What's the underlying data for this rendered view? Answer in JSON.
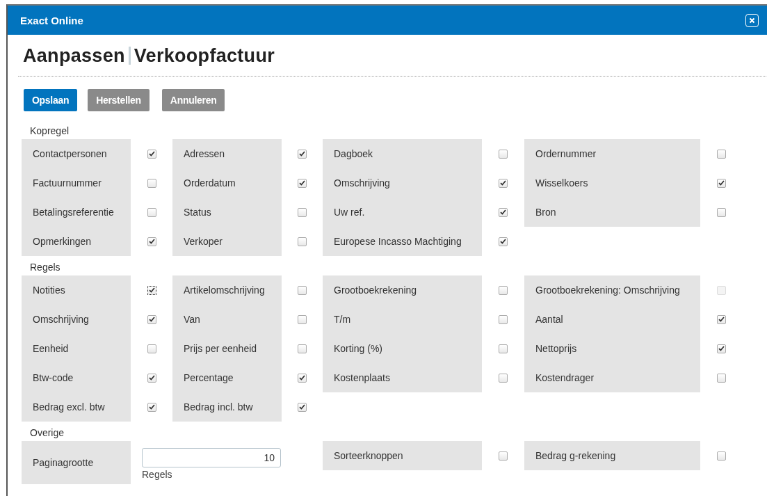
{
  "window": {
    "title": "Exact Online"
  },
  "heading": {
    "action": "Aanpassen",
    "subject": "Verkoopfactuur"
  },
  "buttons": [
    {
      "label": "Opslaan",
      "kind": "primary"
    },
    {
      "label": "Herstellen",
      "kind": "secondary"
    },
    {
      "label": "Annuleren",
      "kind": "secondary"
    }
  ],
  "sections": [
    {
      "title": "Kopregel",
      "columns": [
        [
          {
            "label": "Contactpersonen",
            "kind": "checkbox",
            "checked": true
          },
          {
            "label": "Factuurnummer",
            "kind": "checkbox",
            "checked": false
          },
          {
            "label": "Betalingsreferentie",
            "kind": "checkbox",
            "checked": false
          },
          {
            "label": "Opmerkingen",
            "kind": "checkbox",
            "checked": true
          }
        ],
        [
          {
            "label": "Adressen",
            "kind": "checkbox",
            "checked": true
          },
          {
            "label": "Orderdatum",
            "kind": "checkbox",
            "checked": true
          },
          {
            "label": "Status",
            "kind": "checkbox",
            "checked": false
          },
          {
            "label": "Verkoper",
            "kind": "checkbox",
            "checked": false
          }
        ],
        [
          {
            "label": "Dagboek",
            "kind": "checkbox",
            "checked": false
          },
          {
            "label": "Omschrijving",
            "kind": "checkbox",
            "checked": true
          },
          {
            "label": "Uw ref.",
            "kind": "checkbox",
            "checked": true
          },
          {
            "label": "Europese Incasso Machtiging",
            "kind": "checkbox",
            "checked": true
          }
        ],
        [
          {
            "label": "Ordernummer",
            "kind": "checkbox",
            "checked": false
          },
          {
            "label": "Wisselkoers",
            "kind": "checkbox",
            "checked": true
          },
          {
            "label": "Bron",
            "kind": "checkbox",
            "checked": false
          }
        ]
      ]
    },
    {
      "title": "Regels",
      "columns": [
        [
          {
            "label": "Notities",
            "kind": "checkbox",
            "checked": true,
            "focused": true
          },
          {
            "label": "Omschrijving",
            "kind": "checkbox",
            "checked": true
          },
          {
            "label": "Eenheid",
            "kind": "checkbox",
            "checked": false
          },
          {
            "label": "Btw-code",
            "kind": "checkbox",
            "checked": true
          },
          {
            "label": "Bedrag excl. btw",
            "kind": "checkbox",
            "checked": true
          }
        ],
        [
          {
            "label": "Artikelomschrijving",
            "kind": "checkbox",
            "checked": false
          },
          {
            "label": "Van",
            "kind": "checkbox",
            "checked": false
          },
          {
            "label": "Prijs per eenheid",
            "kind": "checkbox",
            "checked": false
          },
          {
            "label": "Percentage",
            "kind": "checkbox",
            "checked": true
          },
          {
            "label": "Bedrag incl. btw",
            "kind": "checkbox",
            "checked": true
          }
        ],
        [
          {
            "label": "Grootboekrekening",
            "kind": "checkbox",
            "checked": false
          },
          {
            "label": "T/m",
            "kind": "checkbox",
            "checked": false
          },
          {
            "label": "Korting (%)",
            "kind": "checkbox",
            "checked": false
          },
          {
            "label": "Kostenplaats",
            "kind": "checkbox",
            "checked": false
          }
        ],
        [
          {
            "label": "Grootboekrekening: Omschrijving",
            "kind": "checkbox",
            "checked": false,
            "disabled": true
          },
          {
            "label": "Aantal",
            "kind": "checkbox",
            "checked": true
          },
          {
            "label": "Nettoprijs",
            "kind": "checkbox",
            "checked": true
          },
          {
            "label": "Kostendrager",
            "kind": "checkbox",
            "checked": false
          }
        ]
      ]
    },
    {
      "title": "Overige",
      "columns": [
        [
          {
            "label": "Paginagrootte",
            "kind": "number",
            "value": "10",
            "unit": "Regels"
          }
        ],
        [],
        [
          {
            "label": "Sorteerknoppen",
            "kind": "checkbox",
            "checked": false
          }
        ],
        [
          {
            "label": "Bedrag g-rekening",
            "kind": "checkbox",
            "checked": false
          }
        ]
      ]
    }
  ]
}
